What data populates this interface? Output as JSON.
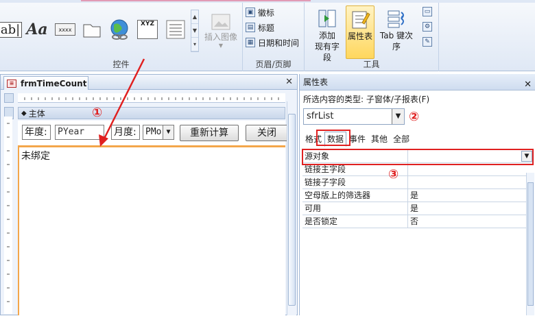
{
  "ribbon": {
    "controls_group_label": "控件",
    "header_footer_group_label": "页眉/页脚",
    "tools_group_label": "工具",
    "textbox_glyph": "ab|",
    "label_glyph": "Aa",
    "button_glyph": "xxxx",
    "option_group_glyph": "XYZ",
    "insert_image_label": "插入图像",
    "logo_label": "徽标",
    "title_label": "标题",
    "datetime_label": "日期和时间",
    "add_fields_label_1": "添加",
    "add_fields_label_2": "现有字段",
    "property_sheet_label": "属性表",
    "tab_order_label": "Tab 键次序"
  },
  "designer": {
    "tab_title": "frmTimeCount",
    "section_label": "主体",
    "year_label": "年度:",
    "year_value": "PYear",
    "month_label": "月度:",
    "month_value": "PMo",
    "recalc_button": "重新计算",
    "close_button": "关闭",
    "unbound_text": "未绑定"
  },
  "property_sheet": {
    "title": "属性表",
    "selection_type": "所选内容的类型: 子窗体/子报表(F)",
    "object_name": "sfrList",
    "tabs": [
      "格式",
      "数据",
      "事件",
      "其他",
      "全部"
    ],
    "rows": [
      {
        "key": "源对象",
        "value": ""
      },
      {
        "key": "链接主字段",
        "value": ""
      },
      {
        "key": "链接子字段",
        "value": ""
      },
      {
        "key": "空母版上的筛选器",
        "value": "是"
      },
      {
        "key": "可用",
        "value": "是"
      },
      {
        "key": "是否锁定",
        "value": "否"
      }
    ]
  },
  "annotations": {
    "n1": "①",
    "n2": "②",
    "n3": "③",
    "color": "#e02020"
  }
}
